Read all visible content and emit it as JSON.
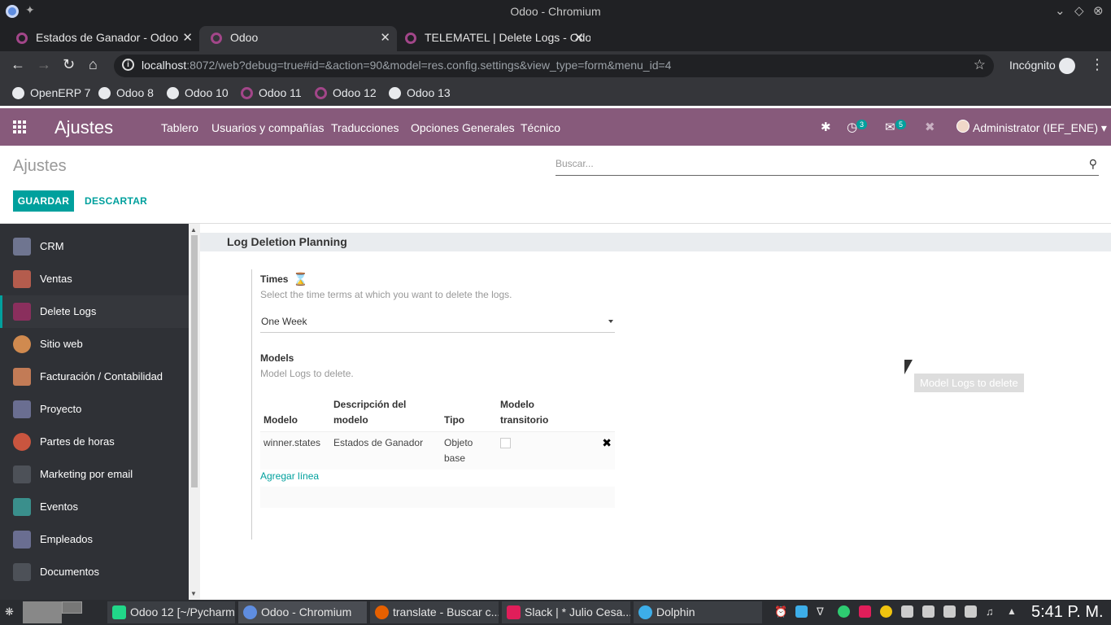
{
  "window": {
    "title": "Odoo - Chromium"
  },
  "tabs": [
    {
      "label": "Estados de Ganador - Odoo",
      "active": false
    },
    {
      "label": "Odoo",
      "active": true
    },
    {
      "label": "TELEMATEL | Delete Logs - Odoo",
      "active": false
    }
  ],
  "address": {
    "host": "localhost",
    "rest": ":8072/web?debug=true#id=&action=90&model=res.config.settings&view_type=form&menu_id=4",
    "profile": "Incógnito"
  },
  "bookmarks": [
    {
      "label": "OpenERP 7",
      "icon": "globe-icon"
    },
    {
      "label": "Odoo 8",
      "icon": "globe-icon"
    },
    {
      "label": "Odoo 10",
      "icon": "globe-icon"
    },
    {
      "label": "Odoo 11",
      "icon": "odoo-icon"
    },
    {
      "label": "Odoo 12",
      "icon": "odoo-icon"
    },
    {
      "label": "Odoo 13",
      "icon": "globe-icon"
    }
  ],
  "odoo_nav": {
    "app_name": "Ajustes",
    "menu": [
      "Tablero",
      "Usuarios y compañías",
      "Traducciones",
      "Opciones Generales",
      "Técnico"
    ],
    "activity_count": "3",
    "message_count": "5",
    "user": "Administrator (IEF_ENE)",
    "brand_color": "#875a7b"
  },
  "control_panel": {
    "breadcrumb": "Ajustes",
    "search_placeholder": "Buscar...",
    "save_label": "GUARDAR",
    "discard_label": "DESCARTAR",
    "accent_color": "#00a09d"
  },
  "sidebar": {
    "items": [
      {
        "label": "CRM",
        "color": "#6f7590",
        "active": false
      },
      {
        "label": "Ventas",
        "color": "#b45c4d",
        "active": false
      },
      {
        "label": "Delete Logs",
        "color": "#8a2f5d",
        "active": true
      },
      {
        "label": "Sitio web",
        "color": "#d08a4f",
        "active": false
      },
      {
        "label": "Facturación / Contabilidad",
        "color": "#c27b56",
        "active": false
      },
      {
        "label": "Proyecto",
        "color": "#6a6e91",
        "active": false
      },
      {
        "label": "Partes de horas",
        "color": "#c9553f",
        "active": false
      },
      {
        "label": "Marketing por email",
        "color": "#4d5158",
        "active": false
      },
      {
        "label": "Eventos",
        "color": "#3a8f8c",
        "active": false
      },
      {
        "label": "Empleados",
        "color": "#6a6e91",
        "active": false
      },
      {
        "label": "Documentos",
        "color": "#4d5158",
        "active": false
      }
    ]
  },
  "section": {
    "title": "Log Deletion Planning",
    "times": {
      "label": "Times",
      "help": "Select the time terms at which you want to delete the logs.",
      "value": "One Week"
    },
    "models": {
      "label": "Models",
      "help": "Model Logs to delete.",
      "columns": [
        "Modelo",
        "Descripción del modelo",
        "Tipo",
        "Modelo transitorio"
      ],
      "rows": [
        {
          "model": "winner.states",
          "description": "Estados de Ganador",
          "type": "Objeto base",
          "transient": false
        }
      ],
      "add_line": "Agregar línea"
    },
    "tooltip": "Model Logs to delete"
  },
  "taskbar": {
    "tasks": [
      {
        "label": "Odoo 12 [~/Pycharm...",
        "color": "#21d789"
      },
      {
        "label": "Odoo - Chromium",
        "color": "#5f8de0"
      },
      {
        "label": "translate - Buscar c...",
        "color": "#e66000"
      },
      {
        "label": "Slack | * Julio Cesa...",
        "color": "#e01e5a"
      },
      {
        "label": "Dolphin",
        "color": "#3daee9"
      }
    ],
    "clock": "5:41 P. M."
  }
}
